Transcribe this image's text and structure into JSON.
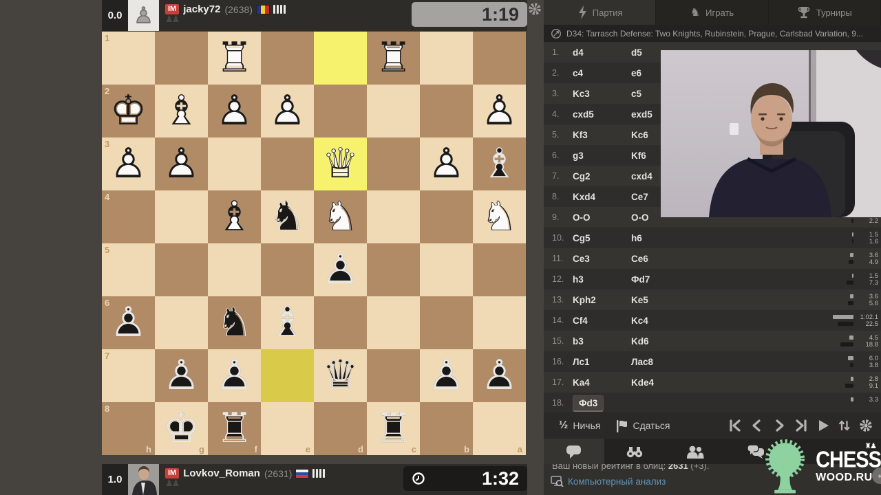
{
  "top_player": {
    "score": "0.0",
    "title": "IM",
    "name": "jacky72",
    "rating": "(2638)",
    "flag": "romania-flag",
    "clock": "1:19",
    "captured": "♟♟"
  },
  "bottom_player": {
    "score": "1.0",
    "title": "IM",
    "name": "Lovkov_Roman",
    "rating": "(2631)",
    "flag": "russia-flag",
    "clock": "1:32",
    "captured": "♟♟"
  },
  "board": {
    "rank_labels": [
      "1",
      "2",
      "3",
      "4",
      "5",
      "6",
      "7",
      "8"
    ],
    "file_labels": [
      "h",
      "g",
      "f",
      "e",
      "d",
      "c",
      "b",
      "a"
    ],
    "highlighted_squares": [
      "d1",
      "d3",
      "e7"
    ],
    "pieces": [
      {
        "square": "f1",
        "color": "w",
        "type": "R"
      },
      {
        "square": "c1",
        "color": "w",
        "type": "R"
      },
      {
        "square": "h2",
        "color": "w",
        "type": "K"
      },
      {
        "square": "g2",
        "color": "w",
        "type": "B"
      },
      {
        "square": "f2",
        "color": "w",
        "type": "P"
      },
      {
        "square": "e2",
        "color": "w",
        "type": "P"
      },
      {
        "square": "a2",
        "color": "w",
        "type": "P"
      },
      {
        "square": "h3",
        "color": "w",
        "type": "P"
      },
      {
        "square": "g3",
        "color": "w",
        "type": "P"
      },
      {
        "square": "d3",
        "color": "w",
        "type": "Q"
      },
      {
        "square": "b3",
        "color": "w",
        "type": "P"
      },
      {
        "square": "a3",
        "color": "b",
        "type": "B"
      },
      {
        "square": "f4",
        "color": "w",
        "type": "B"
      },
      {
        "square": "e4",
        "color": "b",
        "type": "N"
      },
      {
        "square": "d4",
        "color": "w",
        "type": "N"
      },
      {
        "square": "a4",
        "color": "w",
        "type": "N"
      },
      {
        "square": "d5",
        "color": "b",
        "type": "P"
      },
      {
        "square": "h6",
        "color": "b",
        "type": "P"
      },
      {
        "square": "f6",
        "color": "b",
        "type": "N"
      },
      {
        "square": "e6",
        "color": "b",
        "type": "B"
      },
      {
        "square": "g7",
        "color": "b",
        "type": "P"
      },
      {
        "square": "f7",
        "color": "b",
        "type": "P"
      },
      {
        "square": "d7",
        "color": "b",
        "type": "Q"
      },
      {
        "square": "b7",
        "color": "b",
        "type": "P"
      },
      {
        "square": "a7",
        "color": "b",
        "type": "P"
      },
      {
        "square": "g8",
        "color": "b",
        "type": "K"
      },
      {
        "square": "f8",
        "color": "b",
        "type": "R"
      },
      {
        "square": "c8",
        "color": "b",
        "type": "R"
      }
    ],
    "colors": {
      "light": "#f0dab5",
      "dark": "#b18a66",
      "highlight_light": "#f7f26d",
      "highlight_dark": "#d9cb49",
      "label_on_light": "#bf9868",
      "label_on_dark": "#ead7b5"
    }
  },
  "panel": {
    "tabs": [
      {
        "label": "Партия",
        "icon": "lightning-icon",
        "active": true
      },
      {
        "label": "Играть",
        "icon": "knight-icon",
        "active": false
      },
      {
        "label": "Турниры",
        "icon": "trophy-icon",
        "active": false
      }
    ],
    "opening": "D34: Tarrasch Defense: Two Knights, Rubinstein, Prague, Carlsbad Variation, 9...",
    "moves": [
      {
        "num": "1.",
        "white": "d4",
        "black": "d5"
      },
      {
        "num": "2.",
        "white": "c4",
        "black": "e6"
      },
      {
        "num": "3.",
        "white": "Kc3",
        "black": "c5"
      },
      {
        "num": "4.",
        "white": "cxd5",
        "black": "exd5"
      },
      {
        "num": "5.",
        "white": "Kf3",
        "black": "Kc6"
      },
      {
        "num": "6.",
        "white": "g3",
        "black": "Kf6"
      },
      {
        "num": "7.",
        "white": "Cg2",
        "black": "cxd4"
      },
      {
        "num": "8.",
        "white": "Kxd4",
        "black": "Ce7"
      },
      {
        "num": "9.",
        "white": "O-O",
        "black": "O-O",
        "black_time": "2.2",
        "black_bar": 3
      },
      {
        "num": "10.",
        "white": "Cg5",
        "black": "h6",
        "white_time": "1.5",
        "white_bar": 2,
        "black_time": "1.6",
        "black_bar": 2
      },
      {
        "num": "11.",
        "white": "Ce3",
        "black": "Ce6",
        "white_time": "3.6",
        "white_bar": 5,
        "black_time": "4.9",
        "black_bar": 7
      },
      {
        "num": "12.",
        "white": "h3",
        "black": "Фd7",
        "white_time": "1.5",
        "white_bar": 2,
        "black_time": "7.3",
        "black_bar": 10
      },
      {
        "num": "13.",
        "white": "Kph2",
        "black": "Ke5",
        "white_time": "3.6",
        "white_bar": 5,
        "black_time": "5.6",
        "black_bar": 8
      },
      {
        "num": "14.",
        "white": "Cf4",
        "black": "Kc4",
        "white_time": "1:02.1",
        "white_bar": 30,
        "black_time": "22.5",
        "black_bar": 23
      },
      {
        "num": "15.",
        "white": "b3",
        "black": "Kd6",
        "white_time": "4.5",
        "white_bar": 6,
        "black_time": "18.8",
        "black_bar": 19
      },
      {
        "num": "16.",
        "white": "Лc1",
        "black": "Лac8",
        "white_time": "6.0",
        "white_bar": 8,
        "black_time": "3.8",
        "black_bar": 5
      },
      {
        "num": "17.",
        "white": "Ka4",
        "black": "Kde4",
        "white_time": "2.8",
        "white_bar": 4,
        "black_time": "9.1",
        "black_bar": 12
      },
      {
        "num": "18.",
        "white": "Фd3",
        "black": "",
        "current": true,
        "white_time": "3.3",
        "white_bar": 4
      }
    ],
    "controls": {
      "draw_glyph": "½",
      "draw_label": "Ничья",
      "resign_label": "Сдаться"
    },
    "chat": {
      "rating_prefix": "Ваш новый рейтинг в блиц: ",
      "rating_value": "2631",
      "rating_suffix": " (+3).",
      "analysis_link": "Компьютерный анализ"
    }
  },
  "logo": {
    "line1": "CHESS",
    "line2": "WOOD.RU",
    "accent": "#8ed39f"
  }
}
